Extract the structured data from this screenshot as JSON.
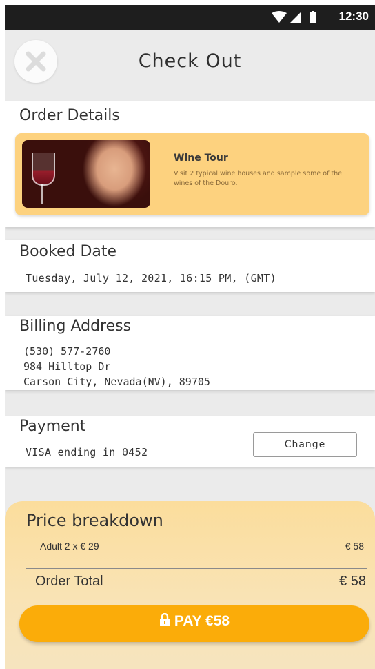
{
  "status_bar": {
    "time": "12:30",
    "icons": [
      "wifi-icon",
      "signal-icon",
      "battery-icon"
    ]
  },
  "header": {
    "title": "Check Out",
    "close_icon": "close-icon"
  },
  "order_details": {
    "title": "Order Details",
    "item": {
      "name": "Wine Tour",
      "description": "Visit 2 typical wine houses and sample some of the wines of the Douro.",
      "image": "woman-with-wine-glass-photo"
    }
  },
  "booked_date": {
    "title": "Booked Date",
    "value": "Tuesday, July 12, 2021, 16:15 PM, (GMT)"
  },
  "billing_address": {
    "title": "Billing Address",
    "phone": "(530) 577-2760",
    "street": "984 Hilltop Dr",
    "city_line": "Carson City, Nevada(NV), 89705"
  },
  "payment": {
    "title": "Payment",
    "method": "VISA ending in 0452",
    "change_label": "Change"
  },
  "price_breakdown": {
    "title": "Price breakdown",
    "line_label": "Adult 2 x € 29",
    "line_value": "€ 58",
    "total_label": "Order Total",
    "total_value": "€ 58"
  },
  "pay_button": {
    "label": "PAY €58",
    "icon": "lock-icon"
  },
  "colors": {
    "accent": "#fbac09",
    "card_bg": "#fdd27f",
    "status_bar": "#1e1e1e"
  }
}
